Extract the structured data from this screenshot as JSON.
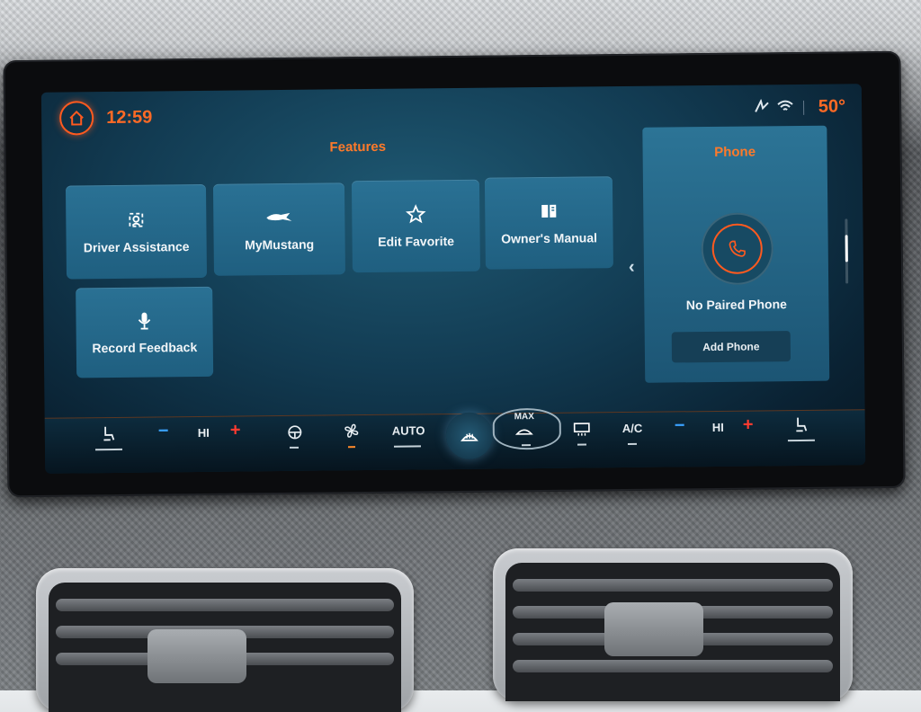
{
  "topbar": {
    "time": "12:59",
    "outside_temp": "50°",
    "home_icon": "home-icon",
    "status_icons": [
      "signal-icon",
      "wifi-icon"
    ]
  },
  "features": {
    "title": "Features",
    "tiles": [
      {
        "label": "Driver Assistance",
        "icon": "driver-assist-icon"
      },
      {
        "label": "MyMustang",
        "icon": "mustang-logo-icon"
      },
      {
        "label": "Edit Favorite",
        "icon": "star-icon"
      },
      {
        "label": "Owner's Manual",
        "icon": "book-icon"
      },
      {
        "label": "Record Feedback",
        "icon": "microphone-icon"
      }
    ]
  },
  "phone": {
    "title": "Phone",
    "status": "No Paired Phone",
    "add_label": "Add Phone"
  },
  "climate": {
    "left_temp": "HI",
    "right_temp": "HI",
    "auto_label": "AUTO",
    "max_label": "MAX",
    "ac_label": "A/C"
  },
  "colors": {
    "accent": "#ff6a25",
    "tile": "#2a7194",
    "screen_bg": "#123b52"
  }
}
